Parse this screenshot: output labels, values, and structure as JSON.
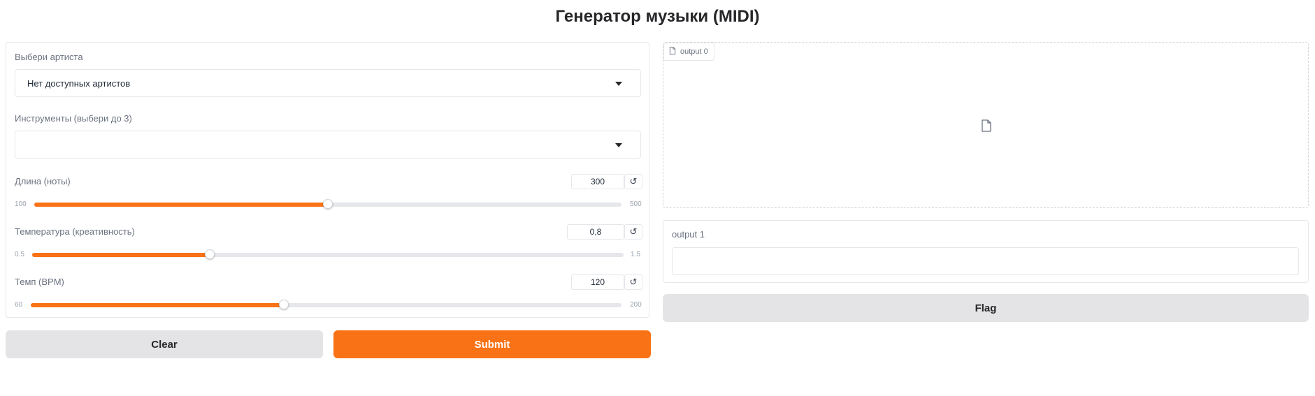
{
  "app": {
    "title": "Генератор музыки (MIDI)"
  },
  "theme": {
    "accent": "#f97316",
    "secondary_button": "#e4e4e7",
    "border": "#e5e7eb"
  },
  "inputs": {
    "artist": {
      "label": "Выбери артиста",
      "value": "Нет доступных артистов",
      "icon": "chevron-down-icon"
    },
    "instruments": {
      "label": "Инструменты (выбери до 3)",
      "value": "",
      "icon": "chevron-down-icon"
    },
    "length": {
      "label": "Длина (ноты)",
      "value": "300",
      "min": "100",
      "max": "500",
      "progress": 0.5,
      "reset_icon": "↺"
    },
    "temperature": {
      "label": "Температура (креативность)",
      "value": "0,8",
      "min": "0.5",
      "max": "1.5",
      "progress": 0.3,
      "reset_icon": "↺"
    },
    "tempo": {
      "label": "Темп (BPM)",
      "value": "120",
      "min": "60",
      "max": "200",
      "progress": 0.4286,
      "reset_icon": "↺"
    }
  },
  "buttons": {
    "clear": "Clear",
    "submit": "Submit",
    "flag": "Flag"
  },
  "outputs": {
    "file": {
      "label": "output 0",
      "icon": "file-icon"
    },
    "text": {
      "label": "output 1",
      "value": ""
    }
  }
}
